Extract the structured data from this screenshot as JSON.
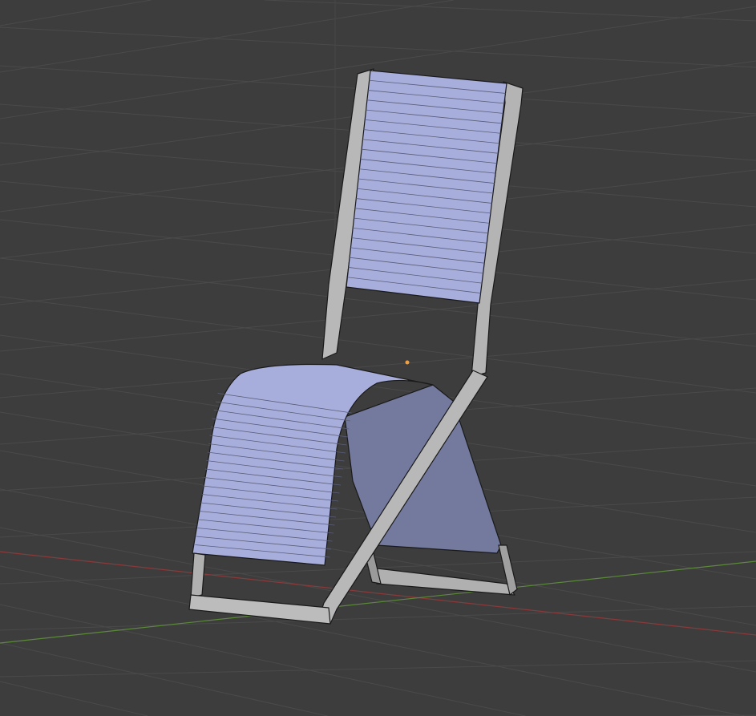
{
  "viewport": {
    "name": "3D Viewport",
    "object": "chair",
    "colors": {
      "background": "#3d3d3d",
      "grid": "#4a4a4a",
      "x_axis": "#8a3a3a",
      "y_axis": "#5c8a3a",
      "frame": "#b4b4b4",
      "frame_shadow": "#8a8a8a",
      "fabric": "#a8aedc",
      "fabric_dark": "#7c82a8",
      "edge": "#1a1a1a",
      "origin": "#f0a040"
    }
  }
}
